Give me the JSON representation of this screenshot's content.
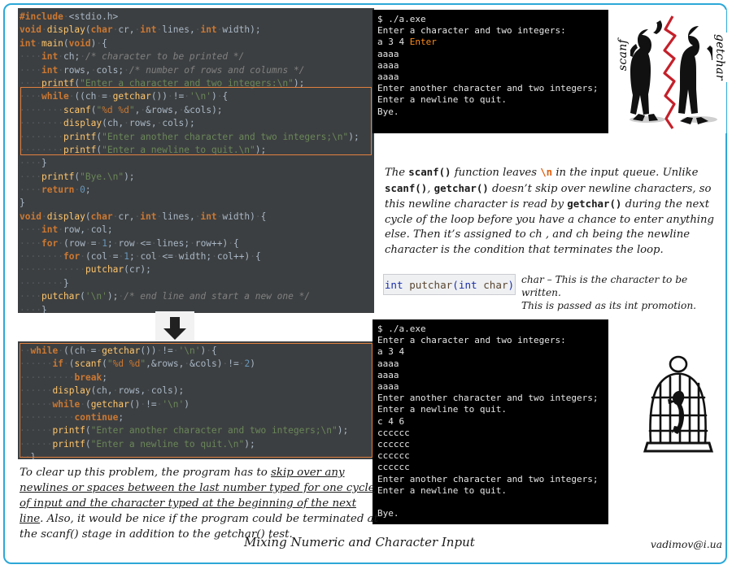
{
  "frame": {
    "border_color": "#2da8d8"
  },
  "caption": "Mixing Numeric and Character Input",
  "credit": "vadimov@i.ua",
  "code_main": {
    "name": "original-program",
    "highlight_color": "#e08040",
    "lines": [
      "#include <stdio.h>",
      "void display(char cr, int lines, int width);",
      "int main(void) {",
      "    int ch; /* character to be printed */",
      "    int rows, cols; /* number of rows and columns */",
      "    printf(\"Enter a character and two integers:\\n\");",
      "    while ((ch = getchar()) != '\\n') {",
      "        scanf(\"%d %d\", &rows, &cols);",
      "        display(ch, rows, cols);",
      "        printf(\"Enter another character and two integers;\\n\");",
      "        printf(\"Enter a newline to quit.\\n\");",
      "    }",
      "    printf(\"Bye.\\n\");",
      "    return 0;",
      "}",
      "void display(char cr, int lines, int width) {",
      "    int row, col;",
      "    for (row = 1; row <= lines; row++) {",
      "        for (col = 1; col <= width; col++) {",
      "            putchar(cr);",
      "        }",
      "    putchar('\\n'); /* end line and start a new one */",
      "    }",
      "}"
    ]
  },
  "code_fixed": {
    "name": "corrected-program",
    "highlight_color": "#e08040",
    "lines": [
      "  while ((ch = getchar()) != '\\n') {",
      "      if (scanf(\"%d %d\",&rows, &cols) != 2)",
      "          break;",
      "      display(ch, rows, cols);",
      "      while (getchar() != '\\n')",
      "          continue;",
      "      printf(\"Enter another character and two integers;\\n\");",
      "      printf(\"Enter a newline to quit.\\n\");",
      "  }"
    ]
  },
  "terminal_top": {
    "title": "first-run-output",
    "lines": [
      "$ ./a.exe",
      "Enter a character and two integers:",
      "a 3 4 Enter",
      "aaaa",
      "aaaa",
      "aaaa",
      "Enter another character and two integers;",
      "Enter a newline to quit.",
      "Bye."
    ],
    "key_token": "Enter",
    "key_token_color": "#ff8c1a"
  },
  "terminal_bottom": {
    "title": "second-run-output",
    "lines": [
      "$ ./a.exe",
      "Enter a character and two integers:",
      "a 3 4",
      "aaaa",
      "aaaa",
      "aaaa",
      "Enter another character and two integers;",
      "Enter a newline to quit.",
      "c 4 6",
      "cccccc",
      "cccccc",
      "cccccc",
      "cccccc",
      "Enter another character and two integers;",
      "Enter a newline to quit.",
      "",
      "Bye."
    ]
  },
  "illustration": {
    "people_alt": "two-silhouettes-back-to-back-with-red-lightning",
    "left_label": "scanf",
    "right_label": "getchar",
    "cage_alt": "bird-in-cage-sketch"
  },
  "explanation": {
    "segments": [
      {
        "t": "The ",
        "s": "i"
      },
      {
        "t": "scanf()",
        "s": "code"
      },
      {
        "t": "  function leaves ",
        "s": "i"
      },
      {
        "t": "\\n",
        "s": "nl"
      },
      {
        "t": " in the input queue. Unlike ",
        "s": "i"
      },
      {
        "t": "scanf()",
        "s": "code"
      },
      {
        "t": ", ",
        "s": "i"
      },
      {
        "t": "getchar()",
        "s": "code"
      },
      {
        "t": " doesn’t skip over newline characters, so this newline character is read by ",
        "s": "i"
      },
      {
        "t": "getchar()",
        "s": "code"
      },
      {
        "t": " during the next cycle of the loop before you have a chance to enter anything else. Then it’s assigned to ch , and ch being the newline character is the condition that terminates the loop.",
        "s": "i"
      }
    ]
  },
  "signature": {
    "return_type": "int",
    "function": "putchar",
    "open": "(",
    "param_type": "int",
    "param_name": "char",
    "close": ")",
    "full": "int putchar(int char)",
    "description_line1": "char – This is the character to be written.",
    "description_line2": "This is passed as its int promotion."
  },
  "bottom_note": {
    "segments": [
      {
        "t": "To clear up this problem, the program has to ",
        "u": false
      },
      {
        "t": "skip over any newlines or spaces between the last number typed for one cycle of input and the character typed at the beginning of the next line",
        "u": true
      },
      {
        "t": ". Also, it would be nice if the program could be terminated at the scanf() stage in addition to the getchar() test.",
        "u": false
      }
    ]
  }
}
